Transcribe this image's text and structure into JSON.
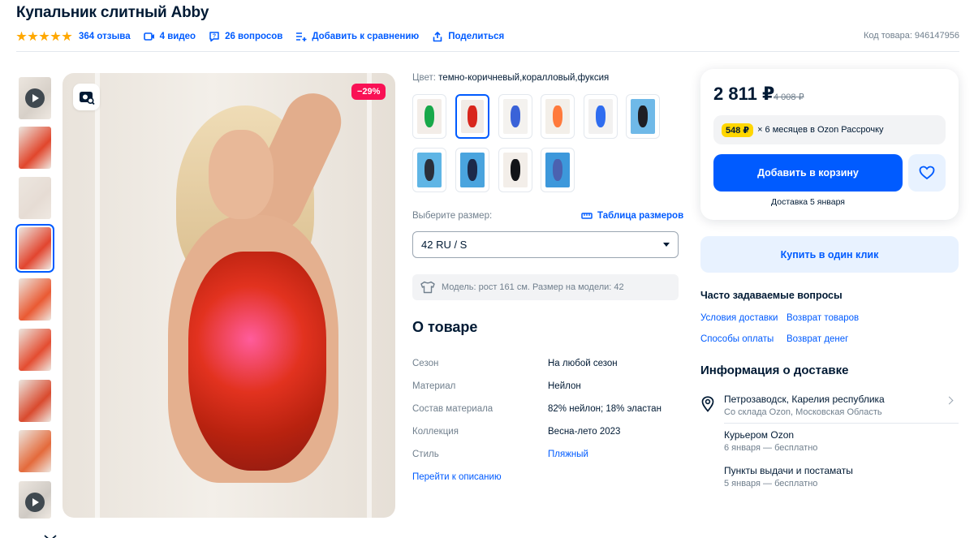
{
  "product": {
    "title": "Купальник слитный Abby",
    "rating_stars": 5,
    "reviews": "364 отзыва",
    "videos": "4 видео",
    "questions": "26 вопросов",
    "compare": "Добавить к сравнению",
    "share": "Поделиться",
    "code": "Код товара: 946147956",
    "discount": "−29%"
  },
  "colors": {
    "label_prefix": "Цвет:",
    "label_value": "темно-коричневый,коралловый,фуксия",
    "selected_index": 1,
    "swatches": [
      {
        "suit": "#18a84a",
        "bg": "#f3ede8"
      },
      {
        "suit": "#d8261c",
        "bg": "#f1ebe6"
      },
      {
        "suit": "#3a62d8",
        "bg": "#f4f2ef"
      },
      {
        "suit": "#ff7a3c",
        "bg": "#f3efe9"
      },
      {
        "suit": "#2f6df0",
        "bg": "#f2f1f0"
      },
      {
        "suit": "#1e1e24",
        "bg": "#6fb9e8"
      },
      {
        "suit": "#2a2f3a",
        "bg": "#5fb5e5"
      },
      {
        "suit": "#1c2a4a",
        "bg": "#4aa4de"
      },
      {
        "suit": "#121418",
        "bg": "#f3eee9"
      },
      {
        "suit": "#4b62b0",
        "bg": "#3d98db"
      }
    ]
  },
  "size": {
    "label": "Выберите размер:",
    "table_link": "Таблица размеров",
    "selected": "42 RU / S",
    "model_note": "Модель: рост 161 см. Размер на модели: 42"
  },
  "about": {
    "title": "О товаре",
    "props": [
      {
        "key": "Сезон",
        "value": "На любой сезон"
      },
      {
        "key": "Материал",
        "value": "Нейлон"
      },
      {
        "key": "Состав материала",
        "value": "82% нейлон; 18% эластан"
      },
      {
        "key": "Коллекция",
        "value": "Весна-лето 2023"
      },
      {
        "key": "Стиль",
        "value": "Пляжный"
      }
    ],
    "goto_desc": "Перейти к описанию"
  },
  "buy": {
    "price": "2 811 ₽",
    "old_price": "4 008 ₽",
    "install_amount": "548 ₽",
    "install_text": "× 6 месяцев в Ozon Рассрочку",
    "cart_button": "Добавить в корзину",
    "delivery_note": "Доставка 5 января",
    "one_click": "Купить в один клик"
  },
  "faq": {
    "title": "Часто задаваемые вопросы",
    "links": [
      "Условия доставки",
      "Возврат товаров",
      "Способы оплаты",
      "Возврат денег"
    ]
  },
  "delivery": {
    "title": "Информация о доставке",
    "location": "Петрозаводск, Карелия республика",
    "warehouse": "Со склада Ozon, Московская Область",
    "courier": "Курьером Ozon",
    "courier_when": "6 января — бесплатно",
    "pickup": "Пункты выдачи и постаматы",
    "pickup_when": "5 января — бесплатно"
  },
  "colors_ui": {
    "brand_blue": "#005bff",
    "text_primary": "#001a34",
    "text_secondary": "#707f8d",
    "discount_pink": "#f91155",
    "installment_yellow": "#ffd600",
    "star_orange": "#ffa800"
  },
  "thumbnails": [
    {
      "kind": "video",
      "bg": "#d7d0c8"
    },
    {
      "kind": "photo",
      "bg": "#e1462c"
    },
    {
      "kind": "photo",
      "bg": "#e6dcd4"
    },
    {
      "kind": "photo",
      "bg": "#e2452f",
      "active": true
    },
    {
      "kind": "photo",
      "bg": "#ea5a33"
    },
    {
      "kind": "photo",
      "bg": "#e44d31"
    },
    {
      "kind": "photo",
      "bg": "#d94a2e"
    },
    {
      "kind": "photo",
      "bg": "#e46a3b"
    },
    {
      "kind": "video",
      "bg": "#cfcac4"
    }
  ]
}
